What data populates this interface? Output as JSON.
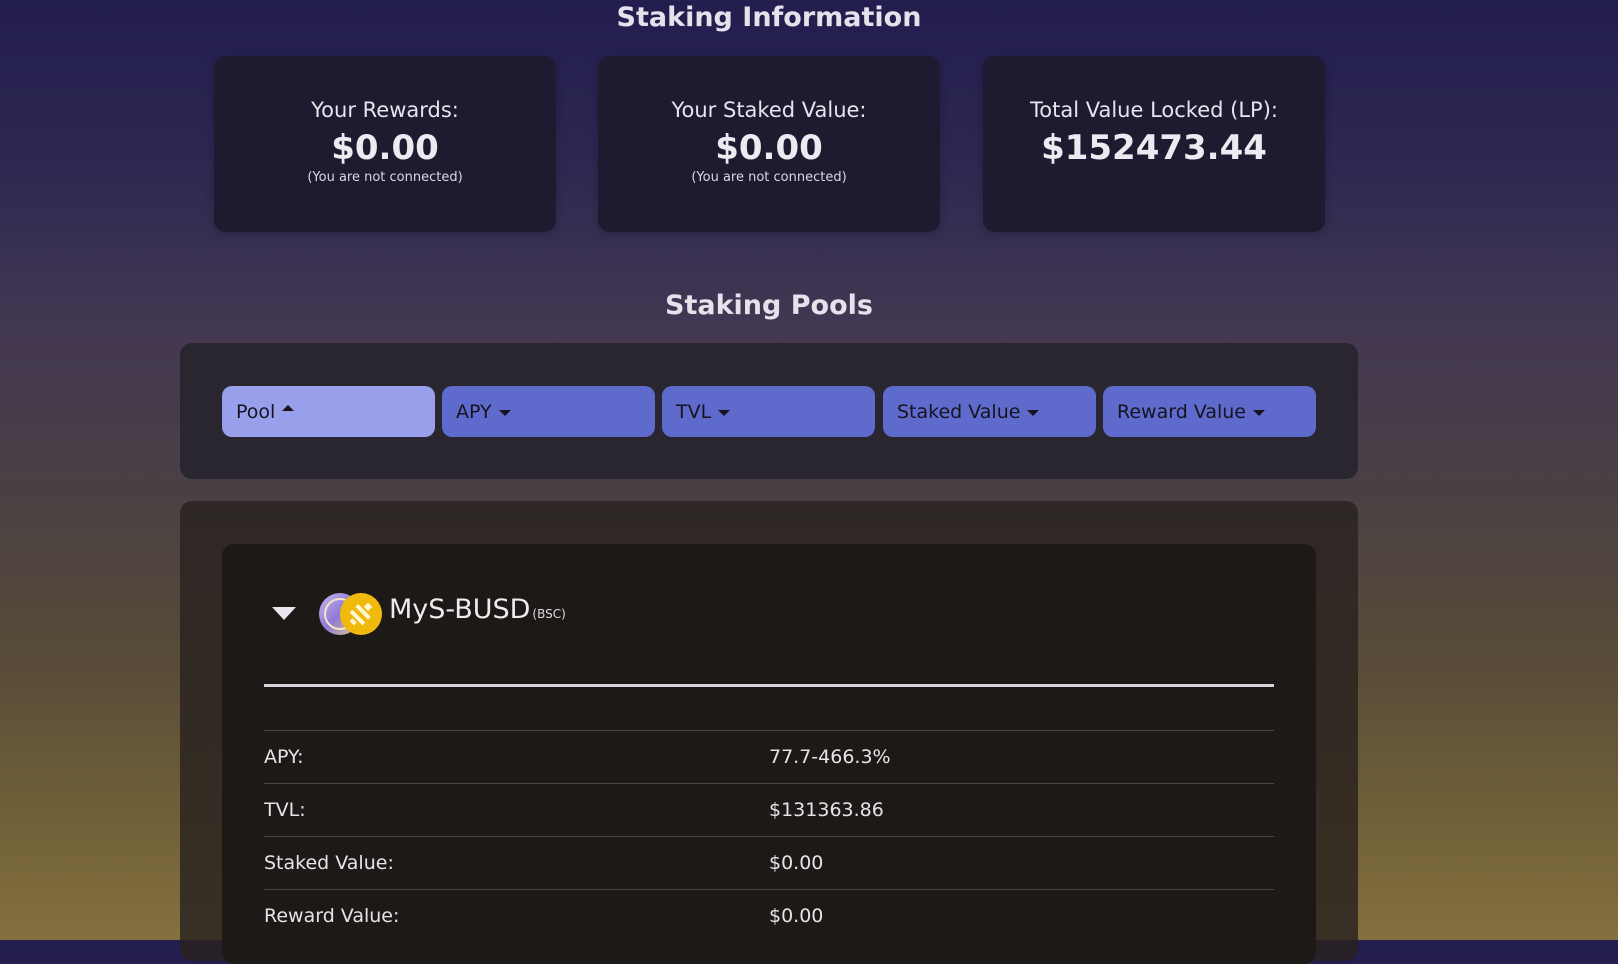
{
  "staking_info": {
    "title": "Staking Information",
    "cards": [
      {
        "label": "Your Rewards:",
        "value": "$0.00",
        "note": "(You are not connected)"
      },
      {
        "label": "Your Staked Value:",
        "value": "$0.00",
        "note": "(You are not connected)"
      },
      {
        "label": "Total Value Locked (LP):",
        "value": "$152473.44",
        "note": ""
      }
    ]
  },
  "staking_pools": {
    "title": "Staking Pools",
    "sort_buttons": [
      {
        "label": "Pool",
        "direction": "up",
        "active": true
      },
      {
        "label": "APY",
        "direction": "down",
        "active": false
      },
      {
        "label": "TVL",
        "direction": "down",
        "active": false
      },
      {
        "label": "Staked Value",
        "direction": "down",
        "active": false
      },
      {
        "label": "Reward Value",
        "direction": "down",
        "active": false
      }
    ],
    "pools": [
      {
        "name": "MyS-BUSD",
        "chain": "(BSC)",
        "rows": [
          {
            "label": "APY:",
            "value": "77.7-466.3%"
          },
          {
            "label": "TVL:",
            "value": "$131363.86"
          },
          {
            "label": "Staked Value:",
            "value": "$0.00"
          },
          {
            "label": "Reward Value:",
            "value": "$0.00"
          }
        ]
      }
    ]
  },
  "colors": {
    "button_active": "#98a0ec",
    "button_default": "#5f6bcc",
    "card_bg": "#1f1a30",
    "busd_gold": "#f0b90b"
  },
  "icons": {
    "expand": "chevron-down-icon",
    "token_pair": "mys-busd-logo"
  }
}
